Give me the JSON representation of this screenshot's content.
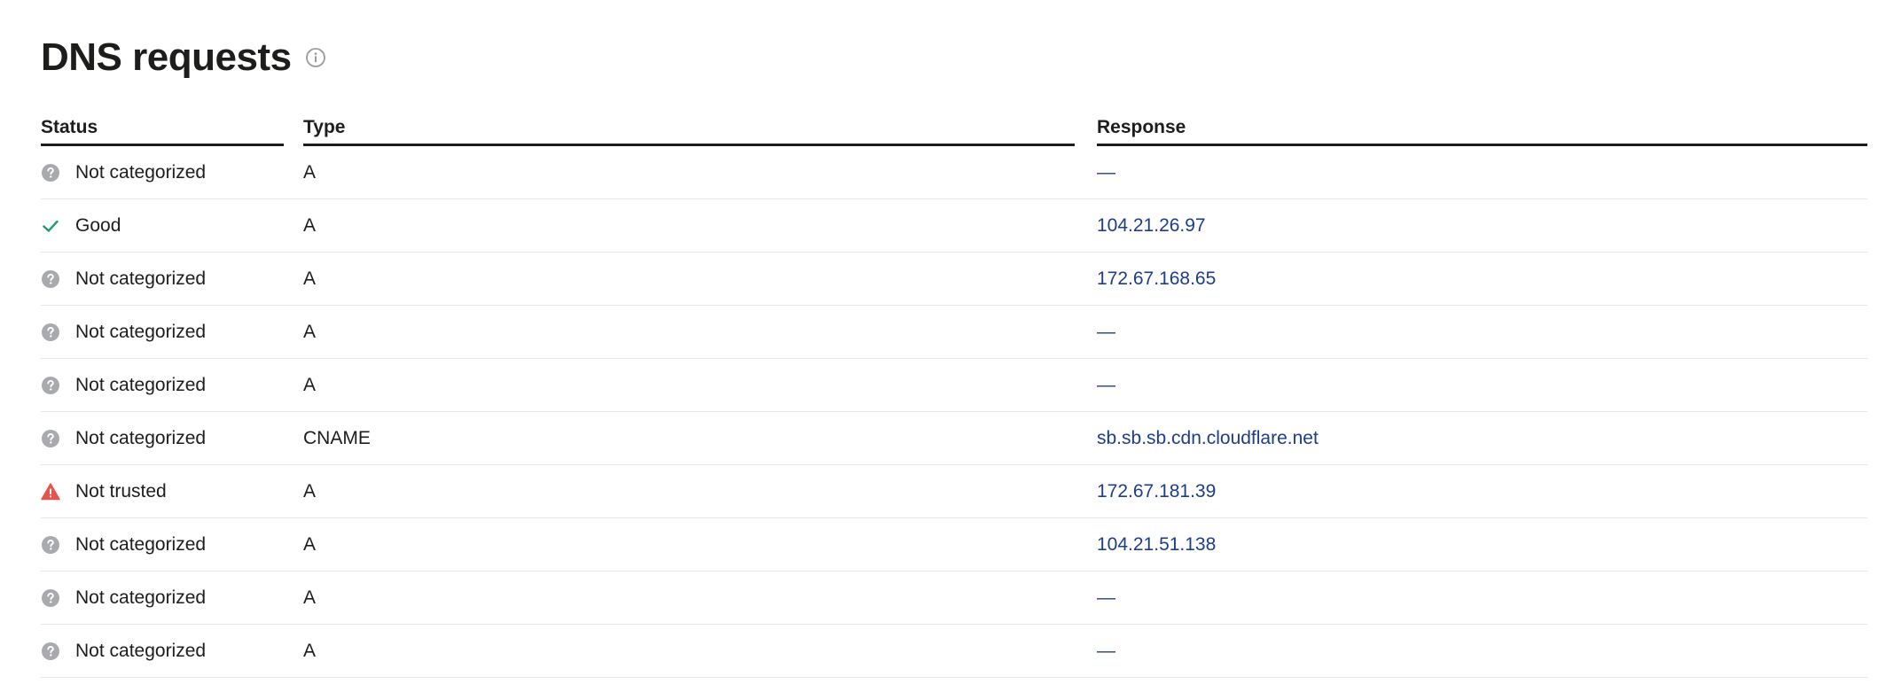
{
  "section": {
    "title": "DNS requests",
    "info_icon": "info-circle-icon"
  },
  "table": {
    "headers": {
      "status": "Status",
      "type": "Type",
      "response": "Response"
    },
    "rows": [
      {
        "status": "Not categorized",
        "status_icon": "question-circle-icon",
        "type": "A",
        "response": "—",
        "is_link": false
      },
      {
        "status": "Good",
        "status_icon": "checkmark-icon",
        "type": "A",
        "response": "104.21.26.97",
        "is_link": true
      },
      {
        "status": "Not categorized",
        "status_icon": "question-circle-icon",
        "type": "A",
        "response": "172.67.168.65",
        "is_link": true
      },
      {
        "status": "Not categorized",
        "status_icon": "question-circle-icon",
        "type": "A",
        "response": "—",
        "is_link": false
      },
      {
        "status": "Not categorized",
        "status_icon": "question-circle-icon",
        "type": "A",
        "response": "—",
        "is_link": false
      },
      {
        "status": "Not categorized",
        "status_icon": "question-circle-icon",
        "type": "CNAME",
        "response": "sb.sb.sb.cdn.cloudflare.net",
        "is_link": true
      },
      {
        "status": "Not trusted",
        "status_icon": "warning-triangle-icon",
        "type": "A",
        "response": "172.67.181.39",
        "is_link": true
      },
      {
        "status": "Not categorized",
        "status_icon": "question-circle-icon",
        "type": "A",
        "response": "104.21.51.138",
        "is_link": true
      },
      {
        "status": "Not categorized",
        "status_icon": "question-circle-icon",
        "type": "A",
        "response": "—",
        "is_link": false
      },
      {
        "status": "Not categorized",
        "status_icon": "question-circle-icon",
        "type": "A",
        "response": "—",
        "is_link": false
      }
    ]
  },
  "colors": {
    "text": "#1d1d1b",
    "link": "#1c3c8c",
    "neutral_icon": "#a9aaad",
    "good": "#1f9a77",
    "danger": "#e5544f",
    "row_divider": "#e6e6e6"
  }
}
